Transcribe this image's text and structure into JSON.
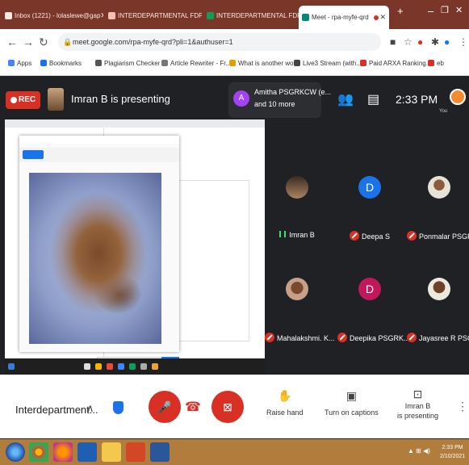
{
  "browser": {
    "tabs": [
      {
        "label": "Inbox (1221) - lolaslewe@gap",
        "color": "#e84c3d"
      },
      {
        "label": "INTERDEPARTMENTAL FDP - I",
        "color": "#e84c3d"
      },
      {
        "label": "INTERDEPARTMENTAL FDP - I",
        "color": "#0f9d58"
      },
      {
        "label": "Meet - rpa-myfe-qrd",
        "color": "#00897b"
      }
    ],
    "url": "meet.google.com/rpa-myfe-qrd?pli=1&authuser=1",
    "bookmarks": [
      "Apps",
      "Bookmarks",
      "Plagiarism Checker",
      "Article Rewriter - Fr...",
      "What is another wo...",
      "Live3 Stream (with...",
      "Paid ARXA Ranking...",
      "eb"
    ]
  },
  "meet": {
    "rec_label": "REC",
    "presenting_title": "Imran B is presenting",
    "notification": {
      "line1": "Amitha PSGRKCW (e...",
      "line2": "and 10 more",
      "avatar_letter": "A"
    },
    "clock": "2:33 PM",
    "you_label": "You",
    "participants": [
      {
        "name": "Imran B",
        "mic": "on",
        "avatar": "photo"
      },
      {
        "name": "Deepa S",
        "mic": "off",
        "avatar": "D"
      },
      {
        "name": "Ponmalar PSGR...",
        "mic": "off",
        "avatar": "photo"
      },
      {
        "name": "Mahalakshmi. K...",
        "mic": "off",
        "avatar": "photo"
      },
      {
        "name": "Deepika PSGRK...",
        "mic": "off",
        "avatar": "D"
      },
      {
        "name": "Jayasree R PSG...",
        "mic": "off",
        "avatar": "photo"
      }
    ],
    "meeting_title": "Interdepartment...",
    "controls": {
      "raise_hand": "Raise hand",
      "captions": "Turn on captions",
      "presenting_line1": "Imran B",
      "presenting_line2": "is presenting"
    }
  },
  "taskbar": {
    "time": "2:33 PM",
    "date": "2/10/2021"
  },
  "colors": {
    "tab_strip": "#7a3628",
    "meet_dark": "#202124",
    "red": "#d93025",
    "blue": "#1a73e8",
    "taskbar": "#b07d3c"
  }
}
